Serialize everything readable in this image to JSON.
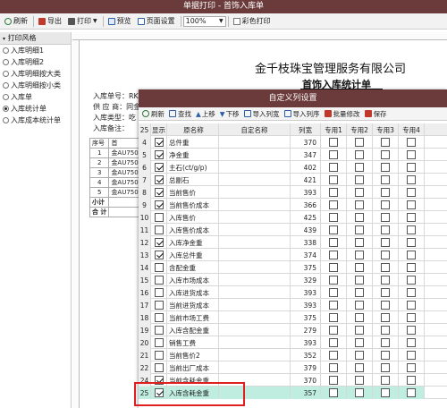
{
  "window": {
    "title": "单据打印 - 首饰入库单"
  },
  "toolbar": {
    "refresh": "刷新",
    "export": "导出",
    "print": "打印",
    "preview": "预览",
    "page_setup": "页面设置",
    "zoom": "100%",
    "color_print": "彩色打印"
  },
  "left_panel": {
    "header": "打印风格",
    "options": [
      "入库明细1",
      "入库明细2",
      "入库明细按大类",
      "入库明细按小类",
      "入库单",
      "入库统计单",
      "入库成本统计单"
    ],
    "selected_index": 5
  },
  "report": {
    "company": "金千枝珠宝管理服务有限公司",
    "title": "首饰入库统计单",
    "info_lines": [
      "入库单号：RK2",
      "供 应 商：同金",
      "入库类型：吃",
      "入库备注："
    ],
    "table_header": [
      "序号",
      "首"
    ],
    "table_rows": [
      {
        "no": "1",
        "code": "金AU750"
      },
      {
        "no": "2",
        "code": "金AU750"
      },
      {
        "no": "3",
        "code": "金AU750"
      },
      {
        "no": "4",
        "code": "金AU750"
      },
      {
        "no": "5",
        "code": "金AU750"
      }
    ],
    "subtotal": "小计",
    "total": "合 计"
  },
  "dialog": {
    "title": "自定义列设置",
    "toolbar": {
      "refresh": "刷新",
      "find": "查找",
      "move_up": "上移",
      "move_down": "下移",
      "import_list": "导入列宽",
      "import_col": "导入列序",
      "batch_edit": "批量修改",
      "save": "保存"
    },
    "columns": {
      "row_count": "25",
      "show": "显示",
      "name": "原名称",
      "custom_name": "自定名称",
      "width": "列宽",
      "special": [
        "专用1",
        "专用2",
        "专用3",
        "专用4"
      ]
    },
    "rows": [
      {
        "no": "4",
        "show": true,
        "name": "总件重",
        "width": "370"
      },
      {
        "no": "5",
        "show": true,
        "name": "净金重",
        "width": "347"
      },
      {
        "no": "6",
        "show": true,
        "name": "主石(ct/g/p)",
        "width": "402"
      },
      {
        "no": "7",
        "show": true,
        "name": "总副石",
        "width": "421"
      },
      {
        "no": "8",
        "show": true,
        "name": "当前售价",
        "width": "393"
      },
      {
        "no": "9",
        "show": true,
        "name": "当前售价成本",
        "width": "366"
      },
      {
        "no": "10",
        "show": false,
        "name": "入库售价",
        "width": "425"
      },
      {
        "no": "11",
        "show": false,
        "name": "入库售价成本",
        "width": "439"
      },
      {
        "no": "12",
        "show": true,
        "name": "入库净金重",
        "width": "338"
      },
      {
        "no": "13",
        "show": true,
        "name": "入库总件重",
        "width": "374"
      },
      {
        "no": "14",
        "show": false,
        "name": "含配金重",
        "width": "375"
      },
      {
        "no": "15",
        "show": false,
        "name": "入库市场成本",
        "width": "329"
      },
      {
        "no": "16",
        "show": false,
        "name": "入库进货成本",
        "width": "393"
      },
      {
        "no": "17",
        "show": false,
        "name": "当前进货成本",
        "width": "393"
      },
      {
        "no": "18",
        "show": false,
        "name": "当前市场工费",
        "width": "375"
      },
      {
        "no": "19",
        "show": false,
        "name": "入库含配金重",
        "width": "279"
      },
      {
        "no": "20",
        "show": false,
        "name": "销售工费",
        "width": "393"
      },
      {
        "no": "21",
        "show": false,
        "name": "当前售价2",
        "width": "352"
      },
      {
        "no": "22",
        "show": false,
        "name": "当前出厂成本",
        "width": "379"
      },
      {
        "no": "24",
        "show": true,
        "name": "当前含耗金重",
        "width": "370"
      },
      {
        "no": "25",
        "show": true,
        "name": "入库含耗金重",
        "width": "357"
      }
    ]
  },
  "colors": {
    "title_bar": "#6b3a3a",
    "selected_row": "#bfeee0",
    "highlight_box": "#e02020"
  }
}
